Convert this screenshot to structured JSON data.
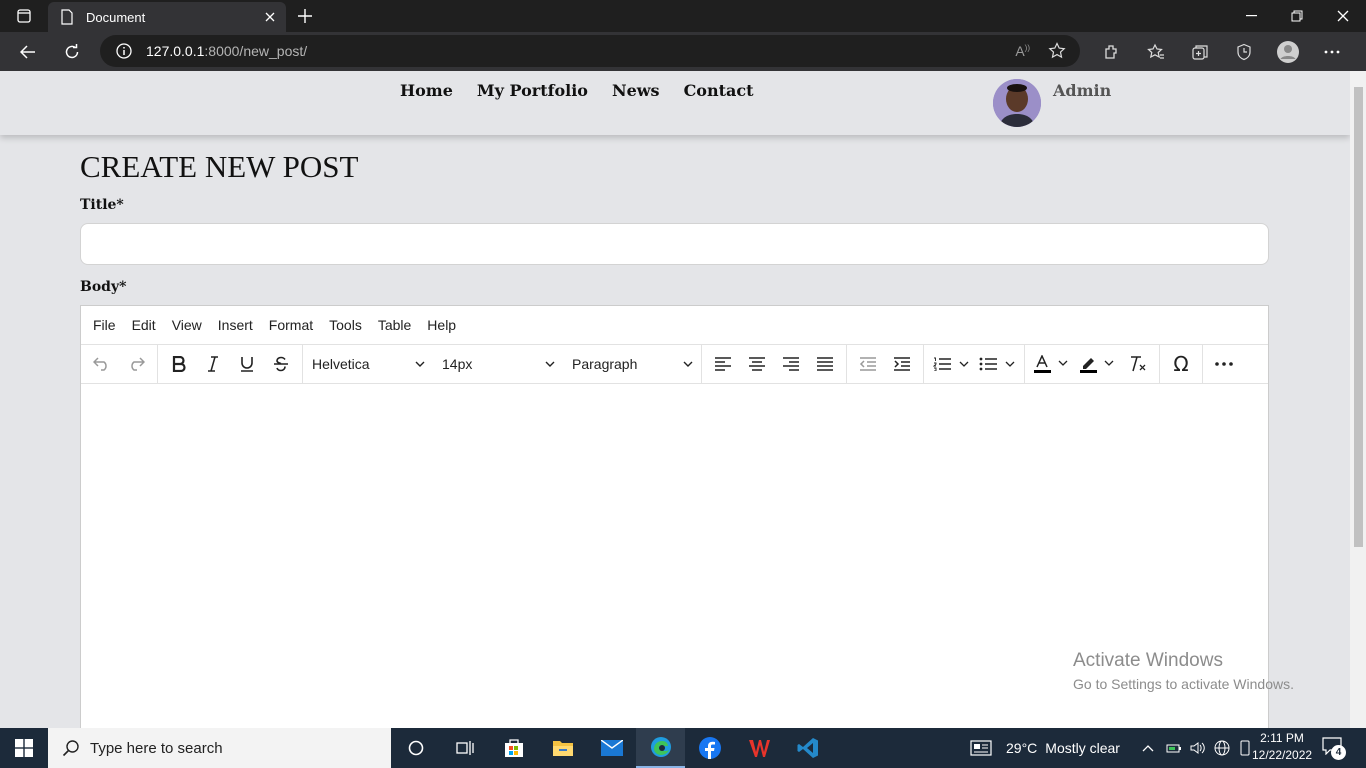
{
  "browser": {
    "tab_title": "Document",
    "url_host": "127.0.0.1",
    "url_rest": ":8000/new_post/"
  },
  "site": {
    "nav": [
      "Home",
      "My Portfolio",
      "News",
      "Contact"
    ],
    "user_name": "Admin"
  },
  "form": {
    "heading": "CREATE NEW POST",
    "title_label": "Title*",
    "body_label": "Body*"
  },
  "editor": {
    "menu": [
      "File",
      "Edit",
      "View",
      "Insert",
      "Format",
      "Tools",
      "Table",
      "Help"
    ],
    "font_family": "Helvetica",
    "font_size": "14px",
    "block_format": "Paragraph"
  },
  "watermark": {
    "line1": "Activate Windows",
    "line2": "Go to Settings to activate Windows."
  },
  "taskbar": {
    "search_placeholder": "Type here to search",
    "weather_temp": "29°C",
    "weather_desc": "Mostly clear",
    "time": "2:11 PM",
    "date": "12/22/2022",
    "notification_count": "4"
  }
}
